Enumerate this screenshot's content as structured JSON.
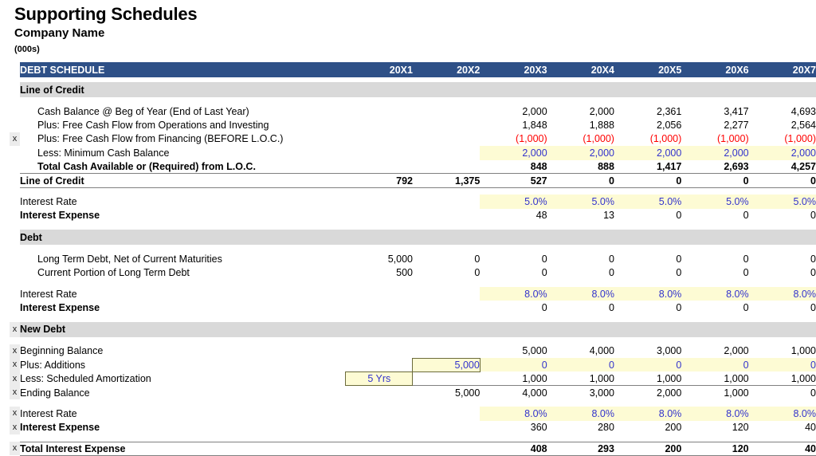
{
  "header": {
    "doc_title": "Supporting Schedules",
    "company_name": "Company Name",
    "units": "(000s)"
  },
  "colors": {
    "header_navy": "#2e5087",
    "section_gray": "#d9d9d9",
    "input_yellow": "#fdfbd4",
    "input_blue_text": "#3333cc",
    "negative_red": "#ff0000",
    "rule_gray": "#808080"
  },
  "table": {
    "title": "DEBT SCHEDULE",
    "years": [
      "20X1",
      "20X2",
      "20X3",
      "20X4",
      "20X5",
      "20X6",
      "20X7"
    ],
    "marker_flag": "x",
    "sections": [
      {
        "name": "Line of Credit"
      },
      {
        "name": "Debt"
      },
      {
        "name": "New Debt"
      }
    ],
    "rows": {
      "cash_balance_beg": {
        "label": "Cash Balance @ Beg of Year (End of Last Year)",
        "values": [
          "",
          "",
          "2,000",
          "2,000",
          "2,361",
          "3,417",
          "4,693"
        ]
      },
      "fcf_ops_investing": {
        "label": "Plus: Free Cash Flow from Operations and Investing",
        "values": [
          "",
          "",
          "1,848",
          "1,888",
          "2,056",
          "2,277",
          "2,564"
        ]
      },
      "fcf_financing": {
        "label": "Plus: Free Cash Flow from Financing (BEFORE L.O.C.)",
        "values": [
          "",
          "",
          "(1,000)",
          "(1,000)",
          "(1,000)",
          "(1,000)",
          "(1,000)"
        ]
      },
      "minimum_cash": {
        "label": "Less: Minimum Cash Balance",
        "values": [
          "",
          "",
          "2,000",
          "2,000",
          "2,000",
          "2,000",
          "2,000"
        ]
      },
      "total_cash_available": {
        "label": "Total Cash Available or (Required) from L.O.C.",
        "values": [
          "",
          "",
          "848",
          "888",
          "1,417",
          "2,693",
          "4,257"
        ]
      },
      "line_of_credit": {
        "label": "Line of Credit",
        "values": [
          "792",
          "1,375",
          "527",
          "0",
          "0",
          "0",
          "0"
        ]
      },
      "loc_interest_rate": {
        "label": "Interest Rate",
        "values": [
          "",
          "",
          "5.0%",
          "5.0%",
          "5.0%",
          "5.0%",
          "5.0%"
        ]
      },
      "loc_interest_expense": {
        "label": "Interest Expense",
        "values": [
          "",
          "",
          "48",
          "13",
          "0",
          "0",
          "0"
        ]
      },
      "ltd_net": {
        "label": "Long Term Debt, Net of Current Maturities",
        "values": [
          "5,000",
          "0",
          "0",
          "0",
          "0",
          "0",
          "0"
        ]
      },
      "current_portion_ltd": {
        "label": "Current Portion of Long Term Debt",
        "values": [
          "500",
          "0",
          "0",
          "0",
          "0",
          "0",
          "0"
        ]
      },
      "debt_interest_rate": {
        "label": "Interest Rate",
        "values": [
          "",
          "",
          "8.0%",
          "8.0%",
          "8.0%",
          "8.0%",
          "8.0%"
        ]
      },
      "debt_interest_expense": {
        "label": "Interest Expense",
        "values": [
          "",
          "",
          "0",
          "0",
          "0",
          "0",
          "0"
        ]
      },
      "beginning_balance": {
        "label": "Beginning Balance",
        "values": [
          "",
          "",
          "5,000",
          "4,000",
          "3,000",
          "2,000",
          "1,000"
        ]
      },
      "plus_additions": {
        "label": "Plus: Additions",
        "values": [
          "",
          "5,000",
          "0",
          "0",
          "0",
          "0",
          "0"
        ]
      },
      "scheduled_amortization": {
        "label": "Less: Scheduled Amortization",
        "values": [
          "5 Yrs",
          "",
          "1,000",
          "1,000",
          "1,000",
          "1,000",
          "1,000"
        ]
      },
      "ending_balance": {
        "label": "Ending Balance",
        "values": [
          "",
          "5,000",
          "4,000",
          "3,000",
          "2,000",
          "1,000",
          "0"
        ]
      },
      "newdebt_interest_rate": {
        "label": "Interest Rate",
        "values": [
          "",
          "",
          "8.0%",
          "8.0%",
          "8.0%",
          "8.0%",
          "8.0%"
        ]
      },
      "newdebt_interest_expense": {
        "label": "Interest Expense",
        "values": [
          "",
          "",
          "360",
          "280",
          "200",
          "120",
          "40"
        ]
      },
      "total_interest_expense": {
        "label": "Total Interest Expense",
        "values": [
          "",
          "",
          "408",
          "293",
          "200",
          "120",
          "40"
        ]
      }
    }
  }
}
